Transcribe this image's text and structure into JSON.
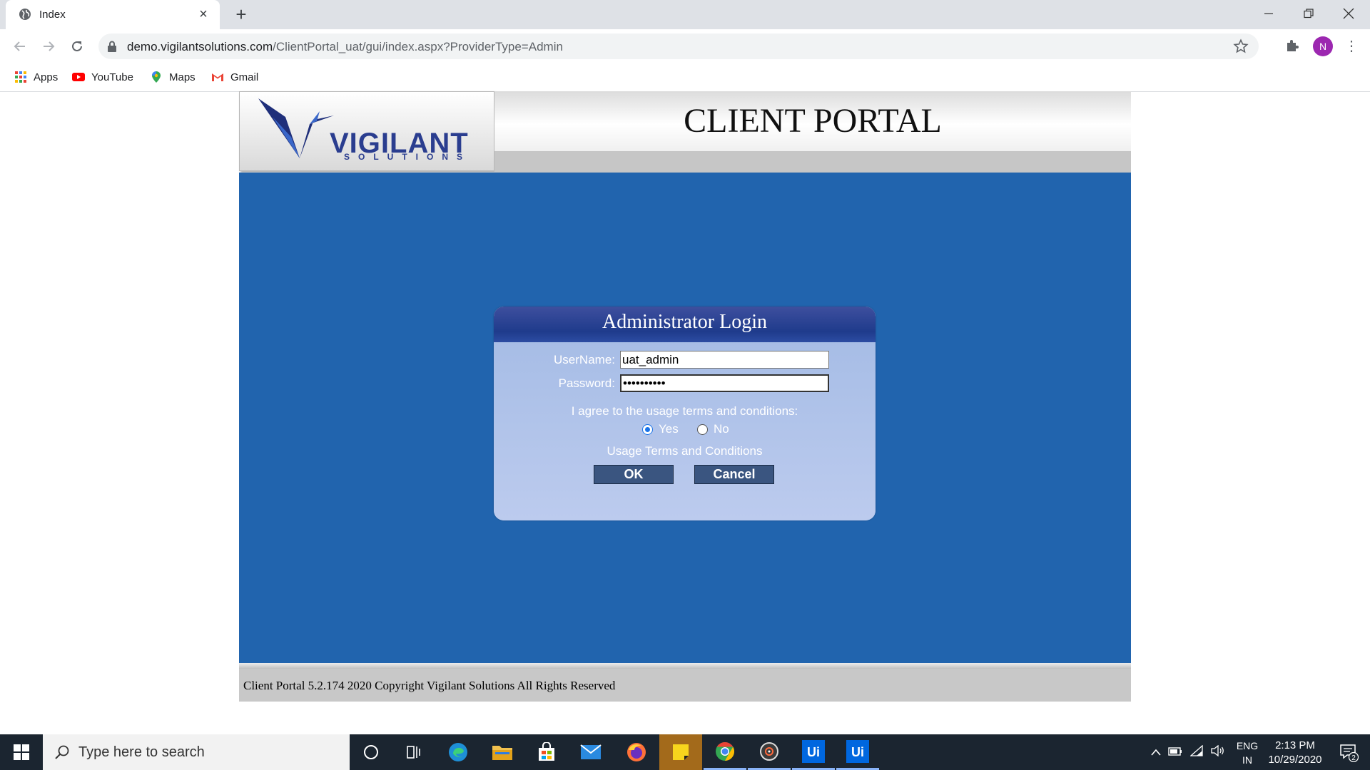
{
  "browser": {
    "tab_title": "Index",
    "url_host": "demo.vigilantsolutions.com",
    "url_path": "/ClientPortal_uat/gui/index.aspx?ProviderType=Admin",
    "avatar_initial": "N",
    "bookmarks": [
      {
        "label": "Apps",
        "icon": "apps-grid-icon"
      },
      {
        "label": "YouTube",
        "icon": "youtube-icon"
      },
      {
        "label": "Maps",
        "icon": "maps-pin-icon"
      },
      {
        "label": "Gmail",
        "icon": "gmail-icon"
      }
    ]
  },
  "page": {
    "logo_word": "VIGILANT",
    "logo_sub": "SOLUTIONS",
    "portal_title": "CLIENT PORTAL",
    "login": {
      "title": "Administrator Login",
      "username_label": "UserName:",
      "username_value": "uat_admin",
      "password_label": "Password:",
      "password_value": "••••••••••",
      "agree_text": "I agree to the usage terms and conditions:",
      "yes_label": "Yes",
      "no_label": "No",
      "yes_selected": true,
      "terms_link": "Usage Terms and Conditions",
      "ok_label": "OK",
      "cancel_label": "Cancel"
    },
    "footer_text": "Client Portal 5.2.174 2020 Copyright Vigilant Solutions All Rights Reserved"
  },
  "taskbar": {
    "search_placeholder": "Type here to search",
    "lang_top": "ENG",
    "lang_bottom": "IN",
    "time": "2:13 PM",
    "date": "10/29/2020",
    "notification_count": "2"
  },
  "colors": {
    "main_bg": "#2164ae",
    "login_head": "#1f3b8c",
    "button": "#3a5580"
  }
}
